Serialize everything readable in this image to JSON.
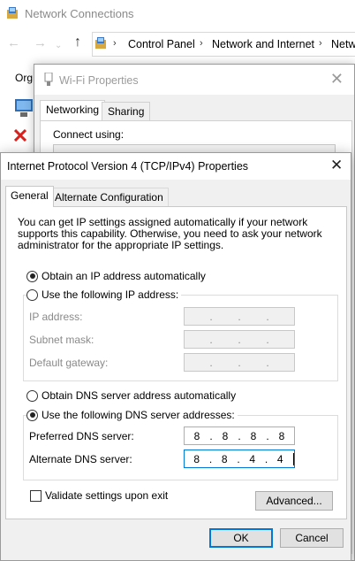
{
  "network_connections": {
    "title": "Network Connections",
    "breadcrumb": [
      "Control Panel",
      "Network and Internet",
      "Network"
    ],
    "toolbar_text": "Org"
  },
  "wifi_properties": {
    "title": "Wi-Fi Properties",
    "tabs": [
      "Networking",
      "Sharing"
    ],
    "connect_using_label": "Connect using:"
  },
  "ipv4_dialog": {
    "title": "Internet Protocol Version 4 (TCP/IPv4) Properties",
    "tabs": [
      "General",
      "Alternate Configuration"
    ],
    "description": "You can get IP settings assigned automatically if your network supports this capability. Otherwise, you need to ask your network administrator for the appropriate IP settings.",
    "ip_mode": {
      "auto_label": "Obtain an IP address automatically",
      "manual_label": "Use the following IP address:",
      "selected": "auto"
    },
    "ip_fields": [
      {
        "label": "IP address:",
        "octets": [
          "",
          "",
          "",
          ""
        ],
        "enabled": false
      },
      {
        "label": "Subnet mask:",
        "octets": [
          "",
          "",
          "",
          ""
        ],
        "enabled": false
      },
      {
        "label": "Default gateway:",
        "octets": [
          "",
          "",
          "",
          ""
        ],
        "enabled": false
      }
    ],
    "dns_mode": {
      "auto_label": "Obtain DNS server address automatically",
      "manual_label": "Use the following DNS server addresses:",
      "selected": "manual"
    },
    "dns_fields": [
      {
        "label": "Preferred DNS server:",
        "octets": [
          "8",
          "8",
          "8",
          "8"
        ],
        "enabled": true
      },
      {
        "label": "Alternate DNS server:",
        "octets": [
          "8",
          "8",
          "4",
          "4"
        ],
        "enabled": true
      }
    ],
    "validate_label": "Validate settings upon exit",
    "validate_checked": false,
    "advanced_label": "Advanced...",
    "ok_label": "OK",
    "cancel_label": "Cancel"
  },
  "icons": {
    "close": "close-icon",
    "back": "back-arrow-icon",
    "forward": "forward-arrow-icon",
    "up": "up-arrow-icon",
    "network_folder": "network-connections-icon"
  },
  "colors": {
    "accent": "#0078d7",
    "dialog_bg": "#f0f0f0",
    "disabled_text": "#8a8a8a"
  }
}
